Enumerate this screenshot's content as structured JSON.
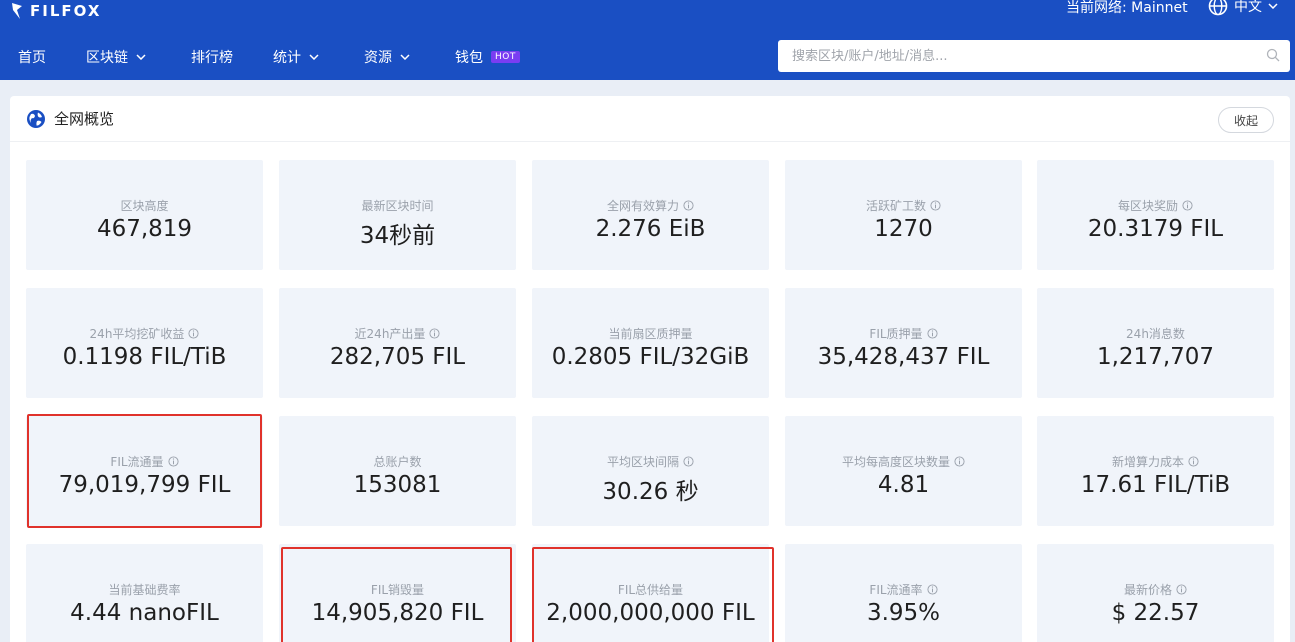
{
  "header": {
    "logo_text": "FILFOX",
    "network_label": "当前网络: Mainnet",
    "language": "中文",
    "nav": [
      {
        "label": "首页",
        "dropdown": false
      },
      {
        "label": "区块链",
        "dropdown": true
      },
      {
        "label": "排行榜",
        "dropdown": false
      },
      {
        "label": "统计",
        "dropdown": true
      },
      {
        "label": "资源",
        "dropdown": true
      },
      {
        "label": "钱包",
        "dropdown": false,
        "badge": "HOT"
      }
    ],
    "search_placeholder": "搜索区块/账户/地址/消息..."
  },
  "panel": {
    "title": "全网概览",
    "collapse_label": "收起",
    "cards": [
      {
        "label": "区块高度",
        "value": "467,819",
        "info": false
      },
      {
        "label": "最新区块时间",
        "value": "34秒前",
        "info": false
      },
      {
        "label": "全网有效算力",
        "value": "2.276 EiB",
        "info": true
      },
      {
        "label": "活跃矿工数",
        "value": "1270",
        "info": true
      },
      {
        "label": "每区块奖励",
        "value": "20.3179 FIL",
        "info": true
      },
      {
        "label": "24h平均挖矿收益",
        "value": "0.1198 FIL/TiB",
        "info": true
      },
      {
        "label": "近24h产出量",
        "value": "282,705 FIL",
        "info": true
      },
      {
        "label": "当前扇区质押量",
        "value": "0.2805 FIL/32GiB",
        "info": false
      },
      {
        "label": "FIL质押量",
        "value": "35,428,437 FIL",
        "info": true
      },
      {
        "label": "24h消息数",
        "value": "1,217,707",
        "info": false
      },
      {
        "label": "FIL流通量",
        "value": "79,019,799 FIL",
        "info": true
      },
      {
        "label": "总账户数",
        "value": "153081",
        "info": false
      },
      {
        "label": "平均区块间隔",
        "value": "30.26 秒",
        "info": true
      },
      {
        "label": "平均每高度区块数量",
        "value": "4.81",
        "info": true
      },
      {
        "label": "新增算力成本",
        "value": "17.61 FIL/TiB",
        "info": true
      },
      {
        "label": "当前基础费率",
        "value": "4.44 nanoFIL",
        "info": false
      },
      {
        "label": "FIL销毁量",
        "value": "14,905,820 FIL",
        "info": false
      },
      {
        "label": "FIL总供给量",
        "value": "2,000,000,000 FIL",
        "info": false
      },
      {
        "label": "FIL流通率",
        "value": "3.95%",
        "info": true
      },
      {
        "label": "最新价格",
        "value": "$ 22.57",
        "info": true
      }
    ]
  },
  "colors": {
    "header_bg": "#1a4fc3",
    "card_bg": "#f0f4fa",
    "highlight": "#e0322b",
    "hot_badge": "#7a3df2"
  }
}
